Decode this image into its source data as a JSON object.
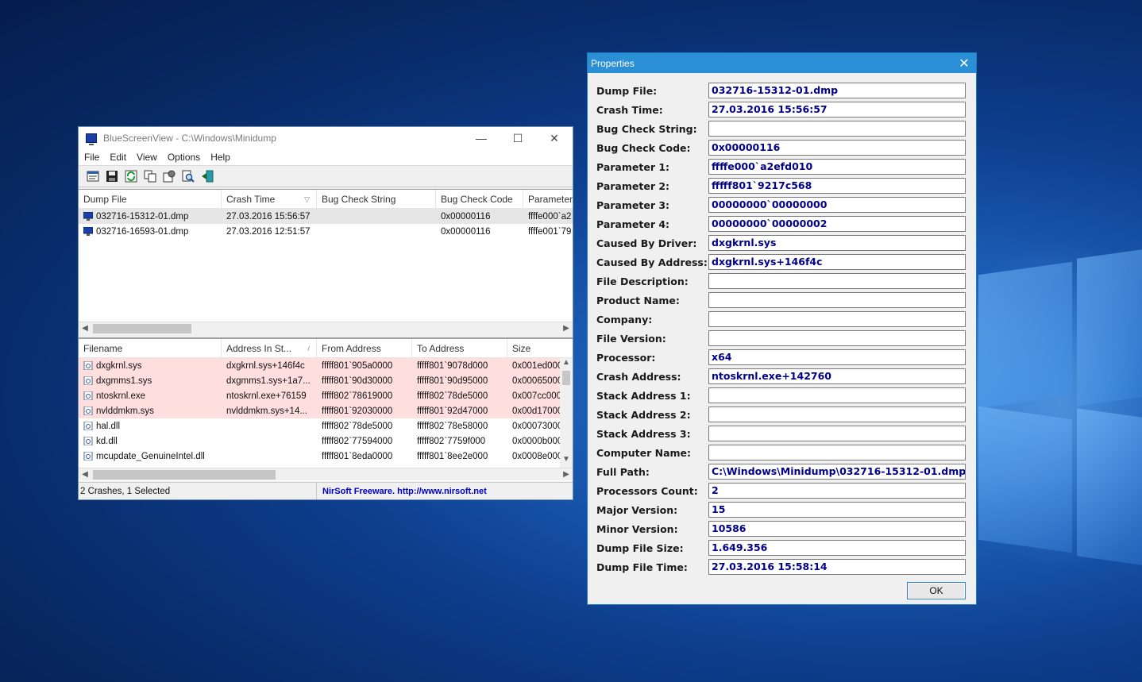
{
  "desktop": {
    "accent": "#0d3d8c"
  },
  "main_window": {
    "title": "BlueScreenView  -  C:\\Windows\\Minidump",
    "minimize_glyph": "—",
    "maximize_glyph": "☐",
    "close_glyph": "✕",
    "menu": [
      "File",
      "Edit",
      "View",
      "Options",
      "Help"
    ],
    "toolbar_icons": [
      "properties-icon",
      "save-icon",
      "refresh-icon",
      "copy-icon",
      "advanced-options-icon",
      "search-icon",
      "exit-icon"
    ],
    "crash_list": {
      "columns": [
        "Dump File",
        "Crash Time",
        "Bug Check String",
        "Bug Check Code",
        "Parameter"
      ],
      "sort_glyph": "▽",
      "rows": [
        {
          "dump_file": "032716-15312-01.dmp",
          "crash_time": "27.03.2016 15:56:57",
          "bug_check_string": "",
          "bug_check_code": "0x00000116",
          "parameter": "ffffe000`a2"
        },
        {
          "dump_file": "032716-16593-01.dmp",
          "crash_time": "27.03.2016 12:51:57",
          "bug_check_string": "",
          "bug_check_code": "0x00000116",
          "parameter": "ffffe001`79"
        }
      ]
    },
    "module_list": {
      "columns": [
        "Filename",
        "Address In St...",
        "From Address",
        "To Address",
        "Size"
      ],
      "sort_glyph": "/",
      "rows": [
        {
          "filename": "dxgkrnl.sys",
          "address": "dxgkrnl.sys+146f4c",
          "from": "fffff801`905a0000",
          "to": "fffff801`9078d000",
          "size": "0x001ed000",
          "highlight": true
        },
        {
          "filename": "dxgmms1.sys",
          "address": "dxgmms1.sys+1a7...",
          "from": "fffff801`90d30000",
          "to": "fffff801`90d95000",
          "size": "0x00065000",
          "highlight": true
        },
        {
          "filename": "ntoskrnl.exe",
          "address": "ntoskrnl.exe+76159",
          "from": "fffff802`78619000",
          "to": "fffff802`78de5000",
          "size": "0x007cc000",
          "highlight": true
        },
        {
          "filename": "nvlddmkm.sys",
          "address": "nvlddmkm.sys+14...",
          "from": "fffff801`92030000",
          "to": "fffff801`92d47000",
          "size": "0x00d17000",
          "highlight": true
        },
        {
          "filename": "hal.dll",
          "address": "",
          "from": "fffff802`78de5000",
          "to": "fffff802`78e58000",
          "size": "0x00073000",
          "highlight": false
        },
        {
          "filename": "kd.dll",
          "address": "",
          "from": "fffff802`77594000",
          "to": "fffff802`7759f000",
          "size": "0x0000b000",
          "highlight": false
        },
        {
          "filename": "mcupdate_GenuineIntel.dll",
          "address": "",
          "from": "fffff801`8eda0000",
          "to": "fffff801`8ee2e000",
          "size": "0x0008e000",
          "highlight": false
        }
      ]
    },
    "status": {
      "left": "2 Crashes, 1 Selected",
      "right": "NirSoft Freeware.  http://www.nirsoft.net"
    }
  },
  "properties": {
    "title": "Properties",
    "close_glyph": "✕",
    "ok_label": "OK",
    "fields": [
      {
        "label": "Dump File:",
        "value": "032716-15312-01.dmp"
      },
      {
        "label": "Crash Time:",
        "value": "27.03.2016 15:56:57"
      },
      {
        "label": "Bug Check String:",
        "value": ""
      },
      {
        "label": "Bug Check Code:",
        "value": "0x00000116"
      },
      {
        "label": "Parameter 1:",
        "value": "ffffe000`a2efd010"
      },
      {
        "label": "Parameter 2:",
        "value": "fffff801`9217c568"
      },
      {
        "label": "Parameter 3:",
        "value": "00000000`00000000"
      },
      {
        "label": "Parameter 4:",
        "value": "00000000`00000002"
      },
      {
        "label": "Caused By Driver:",
        "value": "dxgkrnl.sys"
      },
      {
        "label": "Caused By Address:",
        "value": "dxgkrnl.sys+146f4c"
      },
      {
        "label": "File Description:",
        "value": ""
      },
      {
        "label": "Product Name:",
        "value": ""
      },
      {
        "label": "Company:",
        "value": ""
      },
      {
        "label": "File Version:",
        "value": ""
      },
      {
        "label": "Processor:",
        "value": "x64"
      },
      {
        "label": "Crash Address:",
        "value": "ntoskrnl.exe+142760"
      },
      {
        "label": "Stack Address 1:",
        "value": ""
      },
      {
        "label": "Stack Address 2:",
        "value": ""
      },
      {
        "label": "Stack Address 3:",
        "value": ""
      },
      {
        "label": "Computer Name:",
        "value": ""
      },
      {
        "label": "Full Path:",
        "value": "C:\\Windows\\Minidump\\032716-15312-01.dmp"
      },
      {
        "label": "Processors Count:",
        "value": "2"
      },
      {
        "label": "Major Version:",
        "value": "15"
      },
      {
        "label": "Minor Version:",
        "value": "10586"
      },
      {
        "label": "Dump File Size:",
        "value": "1.649.356"
      },
      {
        "label": "Dump File Time:",
        "value": "27.03.2016 15:58:14"
      }
    ]
  }
}
